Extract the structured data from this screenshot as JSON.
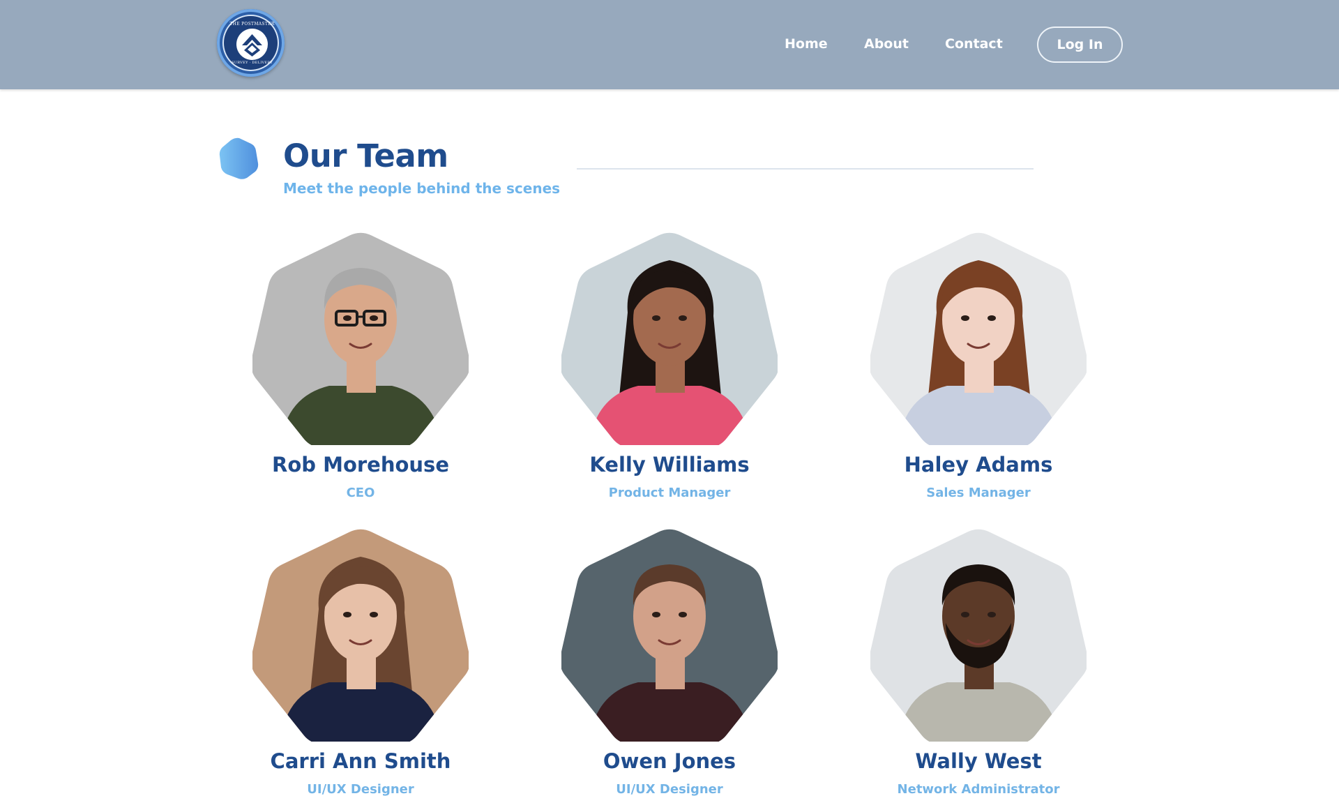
{
  "header": {
    "logo": {
      "text_top": "THE POSTMASTER",
      "text_bottom": "SURVEY · DELIVERY",
      "icon": "chevron-up-icon"
    },
    "nav": [
      "Home",
      "About",
      "Contact"
    ],
    "login_label": "Log In"
  },
  "section": {
    "title": "Our Team",
    "subtitle": "Meet the people behind the scenes"
  },
  "team": [
    {
      "name": "Rob Morehouse",
      "role": "CEO",
      "portrait": "man-glasses-gray-hair",
      "bg": "#b9b9b9",
      "skin": "#d9a88a",
      "hair": "#a9a9a9",
      "shirt": "#3c4a2e"
    },
    {
      "name": "Kelly Williams",
      "role": "Product Manager",
      "portrait": "woman-curly-hair-pink-top",
      "bg": "#c9d3d8",
      "skin": "#a36a4f",
      "hair": "#1d1411",
      "shirt": "#e55273"
    },
    {
      "name": "Haley Adams",
      "role": "Sales Manager",
      "portrait": "woman-long-auburn-hair",
      "bg": "#e6e8ea",
      "skin": "#f1d2c4",
      "hair": "#7a4124",
      "shirt": "#c7cfe0"
    },
    {
      "name": "Carri Ann Smith",
      "role": "UI/UX Designer",
      "portrait": "woman-wavy-blonde-hair",
      "bg": "#c39a7a",
      "skin": "#e7c0a8",
      "hair": "#6a4530",
      "shirt": "#1a2240"
    },
    {
      "name": "Owen Jones",
      "role": "UI/UX Designer",
      "portrait": "man-short-brown-hair",
      "bg": "#56646c",
      "skin": "#d2a189",
      "hair": "#5b3b2b",
      "shirt": "#3a1e22"
    },
    {
      "name": "Wally West",
      "role": "Network Administrator",
      "portrait": "man-beard-sweater",
      "bg": "#dfe2e5",
      "skin": "#5c3a28",
      "hair": "#1a120e",
      "shirt": "#b8b7ad"
    }
  ]
}
